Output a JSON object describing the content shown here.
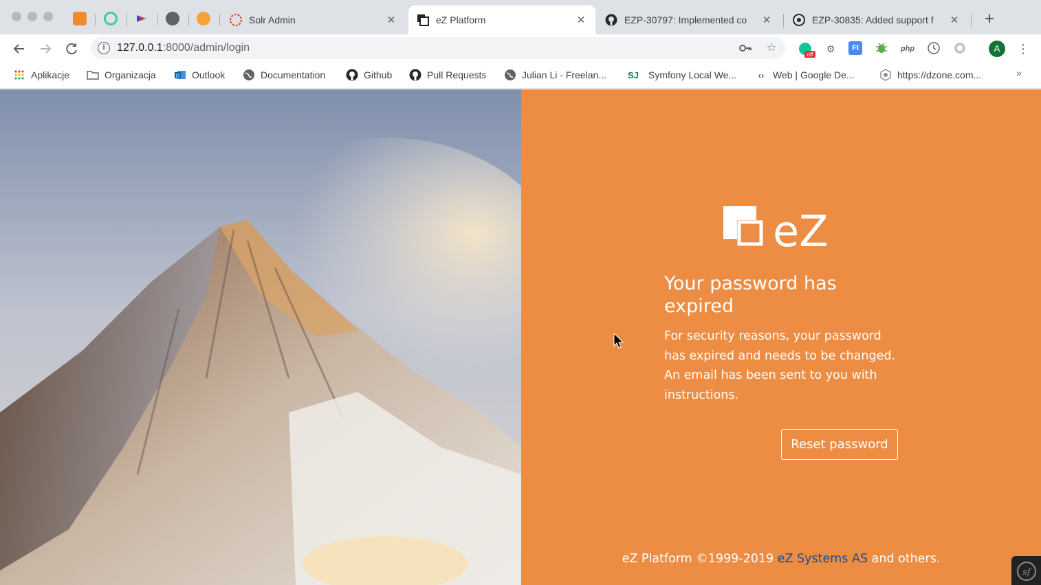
{
  "tabs": {
    "pinned": [
      "cube-favicon",
      "spiral-favicon",
      "arrow-favicon",
      "globe-favicon",
      "flower-favicon"
    ],
    "items": [
      {
        "title": "Solr Admin",
        "icon": "solr-icon"
      },
      {
        "title": "eZ Platform",
        "icon": "ez-platform-icon",
        "active": true
      },
      {
        "title": "EZP-30797: Implemented co",
        "icon": "github-icon"
      },
      {
        "title": "EZP-30835: Added support f",
        "icon": "github-icon"
      }
    ],
    "close_glyph": "✕",
    "new_tab_glyph": "+"
  },
  "toolbar": {
    "url_host": "127.0.0.1",
    "url_path": ":8000/admin/login",
    "extensions": [
      "key-icon",
      "star-icon",
      "grammarly-off-icon",
      "gear-icon",
      "fi-icon",
      "bug-icon",
      "php-icon",
      "clock-icon",
      "shield-icon"
    ],
    "php_label": "php",
    "fi_label": "FI",
    "off_label": "off",
    "avatar_letter": "A"
  },
  "bookmarks": [
    {
      "label": "Aplikacje",
      "icon": "apps-grid-icon"
    },
    {
      "label": "Organizacja",
      "icon": "folder-icon"
    },
    {
      "label": "Outlook",
      "icon": "outlook-icon"
    },
    {
      "label": "Documentation",
      "icon": "globe-icon"
    },
    {
      "label": "Github",
      "icon": "github-icon"
    },
    {
      "label": "Pull Requests",
      "icon": "github-icon"
    },
    {
      "label": "Julian Li - Freelan...",
      "icon": "globe-icon"
    },
    {
      "label": "Symfony Local We...",
      "icon": "symfony-icon"
    },
    {
      "label": "Web  |  Google De...",
      "icon": "code-icon"
    },
    {
      "label": "https://dzone.com...",
      "icon": "dzone-icon"
    }
  ],
  "bookmarks_more": "»",
  "page": {
    "logo_text": "eZ",
    "heading": "Your password has expired",
    "message": "For security reasons, your password has expired and needs to be changed. An email has been sent to you with instructions.",
    "reset_button": "Reset password",
    "footer_prefix": "eZ Platform ©1999-2019 ",
    "footer_link": "eZ Systems AS",
    "footer_suffix": " and others.",
    "accent_color": "#ed8c43",
    "link_color": "#1e4c8f"
  }
}
